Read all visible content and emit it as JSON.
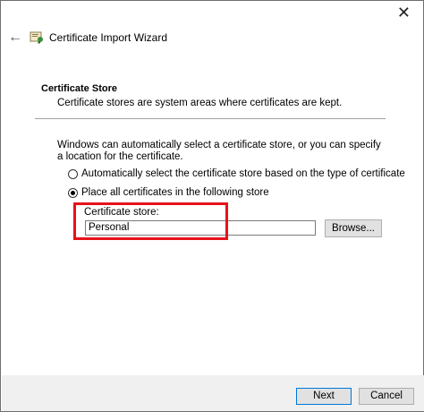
{
  "window": {
    "title": "Certificate Import Wizard",
    "close_glyph": "✕",
    "back_glyph": "←"
  },
  "section": {
    "title": "Certificate Store",
    "description": "Certificate stores are system areas where certificates are kept."
  },
  "intro": "Windows can automatically select a certificate store, or you can specify a location for the certificate.",
  "options": {
    "auto_label": "Automatically select the certificate store based on the type of certificate",
    "auto_selected": false,
    "place_label": "Place all certificates in the following store",
    "place_selected": true
  },
  "store": {
    "label": "Certificate store:",
    "value": "Personal",
    "browse_label": "Browse..."
  },
  "footer": {
    "next_label": "Next",
    "cancel_label": "Cancel"
  },
  "colors": {
    "highlight": "#e8111a",
    "footer_bg": "#f0f0f0",
    "focus_border": "#0078d7"
  },
  "icons": {
    "wizard": "certificate-wizard-icon",
    "back": "back-arrow-icon",
    "close": "close-icon"
  }
}
